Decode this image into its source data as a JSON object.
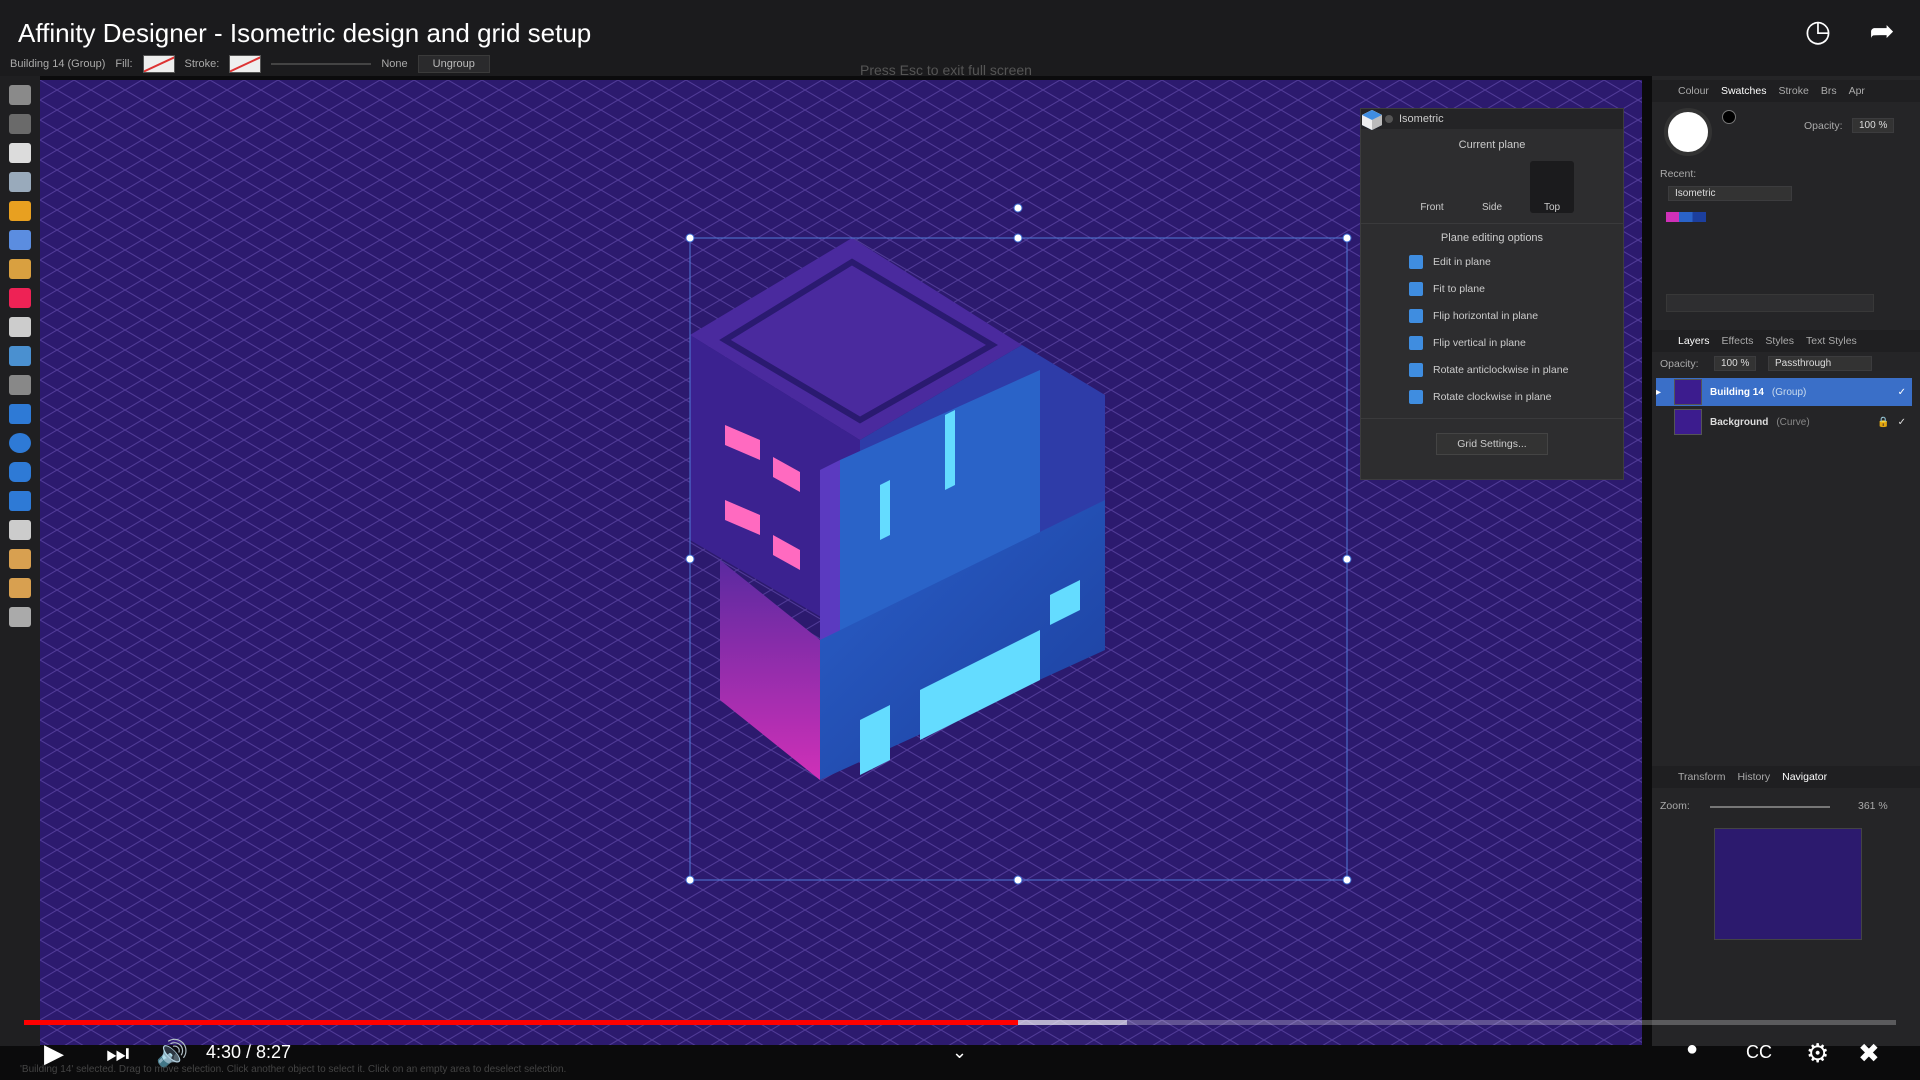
{
  "video": {
    "title": "Affinity Designer - Isometric design and grid setup",
    "time_display": "4:30 / 8:27",
    "progress_fraction": 0.531,
    "buffered_fraction": 0.589
  },
  "context_bar": {
    "selection": "Building 14 (Group)",
    "fill_label": "Fill:",
    "stroke_label": "Stroke:",
    "stroke_none": "None",
    "ungroup_label": "Ungroup"
  },
  "fullscreen_hint": "Press  Esc  to exit full screen",
  "isometric_panel": {
    "title": "Isometric",
    "current_plane_label": "Current plane",
    "planes": [
      "Front",
      "Side",
      "Top"
    ],
    "active_plane": "Top",
    "options_heading": "Plane editing options",
    "options": [
      "Edit in plane",
      "Fit to plane",
      "Flip horizontal in plane",
      "Flip vertical in plane",
      "Rotate anticlockwise in plane",
      "Rotate clockwise in plane"
    ],
    "grid_settings_label": "Grid Settings..."
  },
  "studio": {
    "top_tabs": [
      "Colour",
      "Swatches",
      "Stroke",
      "Brs",
      "Apr"
    ],
    "active_top_tab": "Swatches",
    "opacity_label": "Opacity:",
    "opacity_value": "100 %",
    "recent_label": "Recent:",
    "palette_name": "Isometric",
    "layer_tabs": [
      "Layers",
      "Effects",
      "Styles",
      "Text Styles"
    ],
    "active_layer_tab": "Layers",
    "layer_opacity_label": "Opacity:",
    "layer_opacity_value": "100 %",
    "blend_mode": "Passthrough",
    "layers": [
      {
        "name": "Building 14",
        "type": "(Group)",
        "selected": true
      },
      {
        "name": "Background",
        "type": "(Curve)",
        "selected": false
      }
    ],
    "bottom_tabs": [
      "Transform",
      "History",
      "Navigator"
    ],
    "active_bottom_tab": "Navigator",
    "zoom_label": "Zoom:",
    "zoom_value": "361 %"
  },
  "status_bar": "'Building 14' selected. Drag to move selection. Click another object to select it. Click on an empty area to deselect selection.",
  "colors": {
    "canvas": "#2c1a6e",
    "accent_blue": "#3f8de0",
    "progress_red": "#ff0000"
  }
}
